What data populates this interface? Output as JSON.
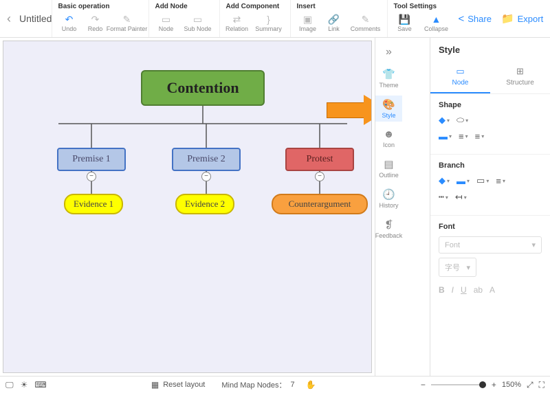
{
  "title": "Untitled",
  "toolbar": {
    "groups": {
      "basic": {
        "title": "Basic operation",
        "undo": "Undo",
        "redo": "Redo",
        "format": "Format Painter"
      },
      "addnode": {
        "title": "Add Node",
        "node": "Node",
        "subnode": "Sub Node"
      },
      "addcomp": {
        "title": "Add Component",
        "relation": "Relation",
        "summary": "Summary"
      },
      "insert": {
        "title": "Insert",
        "image": "Image",
        "link": "Link",
        "comments": "Comments"
      },
      "toolset": {
        "title": "Tool Settings",
        "save": "Save",
        "collapse": "Collapse"
      }
    },
    "share": "Share",
    "export": "Export"
  },
  "canvas": {
    "root": "Contention",
    "p1": "Premise 1",
    "p2": "Premise 2",
    "pr": "Protest",
    "e1": "Evidence 1",
    "e2": "Evidence 2",
    "ca": "Counterargument"
  },
  "sidebar": {
    "theme": "Theme",
    "style": "Style",
    "icon": "Icon",
    "outline": "Outline",
    "history": "History",
    "feedback": "Feedback"
  },
  "panel": {
    "title": "Style",
    "tab_node": "Node",
    "tab_structure": "Structure",
    "shape": "Shape",
    "branch": "Branch",
    "font": "Font",
    "font_placeholder": "Font",
    "size_placeholder": "字号"
  },
  "status": {
    "reset": "Reset layout",
    "nodes_label": "Mind Map Nodes：",
    "nodes_count": "7",
    "zoom": "150%"
  }
}
